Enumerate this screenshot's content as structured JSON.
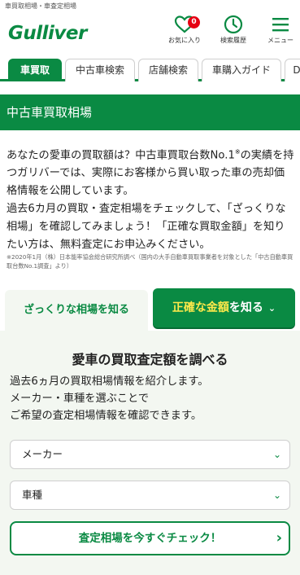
{
  "top_note": "車買取相場・車査定相場",
  "header": {
    "logo": "Gulliver",
    "favorites": {
      "label": "お気に入り",
      "count": "0",
      "icon": "heart-icon"
    },
    "history": {
      "label": "検索履歴",
      "icon": "clock-icon"
    },
    "menu": {
      "label": "メニュー",
      "icon": "hamburger-icon"
    }
  },
  "tabs": [
    {
      "label": "車買取",
      "active": true
    },
    {
      "label": "中古車検索"
    },
    {
      "label": "店舗検索"
    },
    {
      "label": "車購入ガイド"
    },
    {
      "label": "D"
    }
  ],
  "banner_title": "中古車買取相場",
  "intro": {
    "part1": "あなたの愛車の買取額は？中古車買取台数No.1",
    "mark": "※",
    "part2": "の実績を持つガリバーでは、実際にお客様から買い取った車の売却価格情報を公開しています。",
    "part3": "過去6カ月の買取・査定相場をチェックして、「ざっくりな相場」を確認してみましょう！「正確な買取金額」を知りたい方は、無料査定にお申込みください。"
  },
  "footnote": "※2020年1月（株）日本能率協会総合研究所調べ（国内の大手自動車買取事業者を対象とした「中古自動車買取台数No.1調査」より）",
  "choices": {
    "rough": "ざっくりな相場を知る",
    "exact_pre": "正確な金額",
    "exact_post": "を知る",
    "exact_arrow": "⌄"
  },
  "panel": {
    "title": "愛車の買取査定額を調べる",
    "desc_line1": "過去6ヵ月の買取相場情報を紹介します。",
    "desc_line2": "メーカー・車種を選ぶことで",
    "desc_line3": "ご希望の査定相場情報を確認できます。",
    "maker_select": "メーカー",
    "type_select": "車種",
    "check_button": "査定相場を今すぐチェック！"
  },
  "colors": {
    "brand": "#0a8a43",
    "badge": "#e60012",
    "highlight": "#ffe94a"
  }
}
